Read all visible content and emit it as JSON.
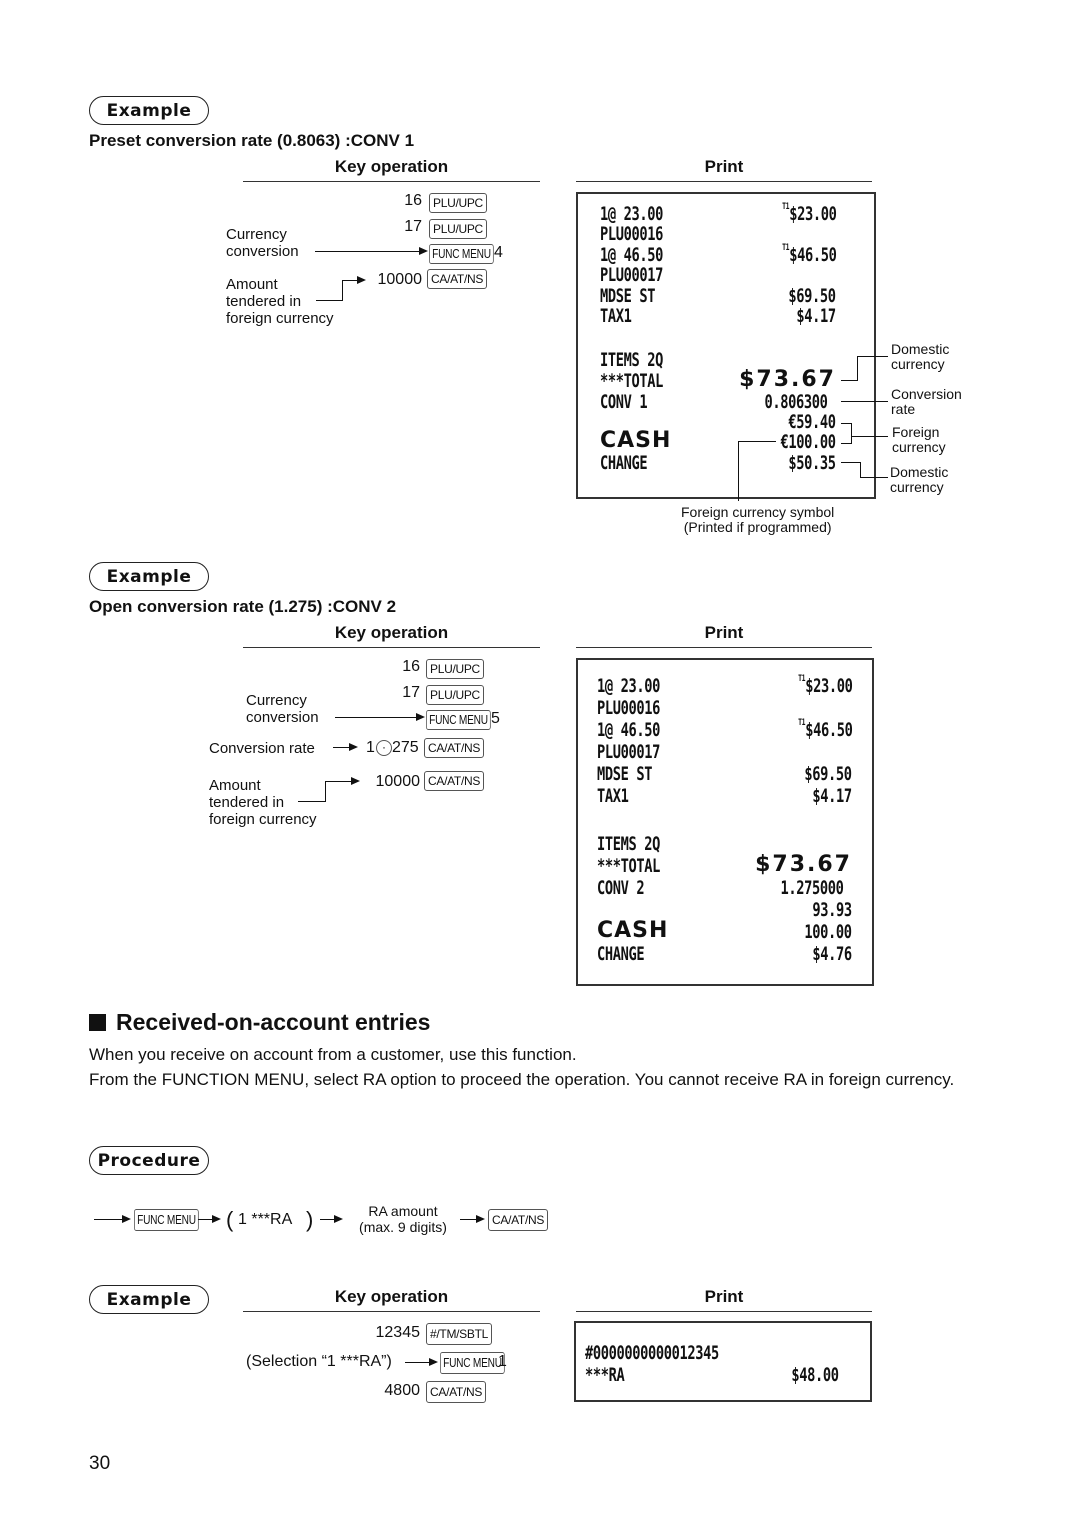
{
  "example1": {
    "badge": "Example",
    "title": "Preset conversion rate (0.8063) :CONV 1",
    "key_operation_header": "Key operation",
    "print_header": "Print",
    "keys": [
      {
        "value": "16",
        "key": "PLU/UPC"
      },
      {
        "value": "17",
        "key": "PLU/UPC"
      },
      {
        "value": "",
        "key": "FUNC MENU",
        "suffix": "4"
      },
      {
        "value": "10000",
        "key": "CA/AT/NS"
      }
    ],
    "labels": {
      "currency_conversion": [
        "Currency",
        "conversion"
      ],
      "amount_tendered": [
        "Amount",
        "tendered in",
        "foreign currency"
      ]
    },
    "receipt": [
      {
        "left": "1@ 23.00",
        "right": "$23.00",
        "mark": "T1"
      },
      {
        "left": "PLU00016",
        "right": ""
      },
      {
        "left": "1@ 46.50",
        "right": "$46.50",
        "mark": "T1"
      },
      {
        "left": "PLU00017",
        "right": ""
      },
      {
        "left": "MDSE ST",
        "right": "$69.50"
      },
      {
        "left": "TAX1",
        "right": "$4.17"
      },
      {
        "left": "ITEMS 2Q",
        "right": ""
      },
      {
        "left": "***TOTAL",
        "right": "$73.67"
      },
      {
        "left": "CONV 1",
        "right": "0.806300"
      },
      {
        "left": "",
        "right": "€59.40"
      },
      {
        "left": "CASH",
        "right": "€100.00"
      },
      {
        "left": "CHANGE",
        "right": "$50.35"
      }
    ],
    "annotations": {
      "domestic_1": [
        "Domestic",
        "currency"
      ],
      "conversion_rate": [
        "Conversion",
        "rate"
      ],
      "foreign": [
        "Foreign",
        "currency"
      ],
      "domestic_2": [
        "Domestic",
        "currency"
      ],
      "symbol_note": [
        "Foreign currency symbol",
        "(Printed if programmed)"
      ]
    }
  },
  "example2": {
    "badge": "Example",
    "title": "Open conversion rate (1.275) :CONV 2",
    "key_operation_header": "Key operation",
    "print_header": "Print",
    "keys": [
      {
        "value": "16",
        "key": "PLU/UPC"
      },
      {
        "value": "17",
        "key": "PLU/UPC"
      },
      {
        "value": "",
        "key": "FUNC MENU",
        "suffix": "5"
      },
      {
        "value_pre": "1",
        "decimal_key": "·",
        "value": "275",
        "key": "CA/AT/NS"
      },
      {
        "value": "10000",
        "key": "CA/AT/NS"
      }
    ],
    "labels": {
      "currency_conversion": [
        "Currency",
        "conversion"
      ],
      "conversion_rate": "Conversion rate",
      "amount_tendered": [
        "Amount",
        "tendered in",
        "foreign currency"
      ]
    },
    "receipt": [
      {
        "left": "1@ 23.00",
        "right": "$23.00",
        "mark": "T1"
      },
      {
        "left": "PLU00016",
        "right": ""
      },
      {
        "left": "1@ 46.50",
        "right": "$46.50",
        "mark": "T1"
      },
      {
        "left": "PLU00017",
        "right": ""
      },
      {
        "left": "MDSE ST",
        "right": "$69.50"
      },
      {
        "left": "TAX1",
        "right": "$4.17"
      },
      {
        "left": "ITEMS 2Q",
        "right": ""
      },
      {
        "left": "***TOTAL",
        "right": "$73.67"
      },
      {
        "left": "CONV 2",
        "right": "1.275000"
      },
      {
        "left": "",
        "right": "93.93"
      },
      {
        "left": "CASH",
        "right": "100.00"
      },
      {
        "left": "CHANGE",
        "right": "$4.76"
      }
    ]
  },
  "ra_section": {
    "title": "Received-on-account entries",
    "paragraph1": "When you receive on account from a customer, use this function.",
    "paragraph2": "From the FUNCTION MENU, select RA option to proceed the operation. You cannot receive RA in foreign currency.",
    "procedure_badge": "Procedure",
    "procedure": {
      "key1": "FUNC MENU",
      "selection": "1 ***RA",
      "amount_line1": "RA amount",
      "amount_line2": "(max. 9 digits)",
      "key2": "CA/AT/NS"
    },
    "example": {
      "badge": "Example",
      "key_operation_header": "Key operation",
      "print_header": "Print",
      "keys": [
        {
          "value": "12345",
          "key": "#/TM/SBTL"
        },
        {
          "value": "(Selection “1 ***RA”)",
          "key": "FUNC MENU",
          "suffix": "1"
        },
        {
          "value": "4800",
          "key": "CA/AT/NS"
        }
      ],
      "receipt": [
        {
          "left": "#0000000000012345",
          "right": ""
        },
        {
          "left": "***RA",
          "right": "$48.00"
        }
      ]
    }
  },
  "page_number": "30"
}
